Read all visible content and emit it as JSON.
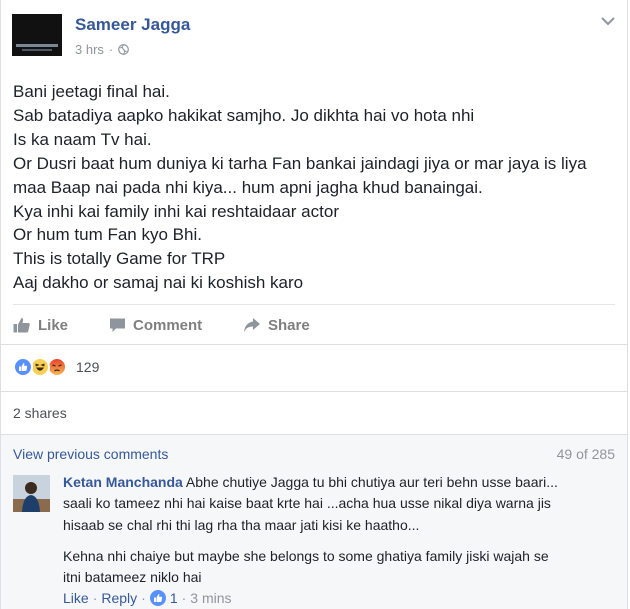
{
  "post": {
    "author": "Sameer Jagga",
    "timestamp": "3 hrs",
    "separator": "·",
    "privacy_icon": "globe-icon",
    "menu_icon": "chevron-down-icon",
    "lines": [
      "Bani jeetagi final hai.",
      "Sab batadiya aapko hakikat samjho. Jo dikhta hai vo hota nhi",
      "Is ka naam Tv hai.",
      "Or Dusri baat hum duniya ki tarha Fan bankai jaindagi jiya or mar jaya is liya",
      "maa Baap nai pada nhi kiya... hum apni jagha khud banaingai.",
      "Kya inhi kai family inhi kai reshtaidaar actor",
      "Or hum tum Fan kyo Bhi.",
      "This is totally Game for TRP",
      "Aaj dakho or samaj nai ki koshish karo"
    ]
  },
  "actions": {
    "like": "Like",
    "comment": "Comment",
    "share": "Share"
  },
  "reactions": {
    "types": [
      "like",
      "haha",
      "angry"
    ],
    "count": "129"
  },
  "shares": "2 shares",
  "comments": {
    "view_previous": "View previous comments",
    "counter": "49 of 285",
    "items": [
      {
        "author": "Ketan Manchanda",
        "line1": " Abhe chutiye Jagga tu bhi chutiya aur teri behn usse baari...",
        "line2": "saali ko tameez nhi hai kaise baat krte hai ...acha hua usse nikal diya warna jis",
        "line3": "hisaab se chal rhi thi lag rha tha maar jati kisi ke haatho...",
        "line4": "Kehna nhi chaiye but maybe she belongs to some ghatiya family jiski wajah se",
        "line5": "itni batameez niklo hai",
        "like": "Like",
        "dot": "·",
        "reply": "Reply",
        "likes": "1",
        "time": "3 mins"
      }
    ]
  },
  "colors": {
    "link": "#365899",
    "muted": "#90949c",
    "text": "#1d2129",
    "like_blue": "#5890ff",
    "haha_yellow": "#f7d055",
    "angry_red": "#e9710f"
  }
}
